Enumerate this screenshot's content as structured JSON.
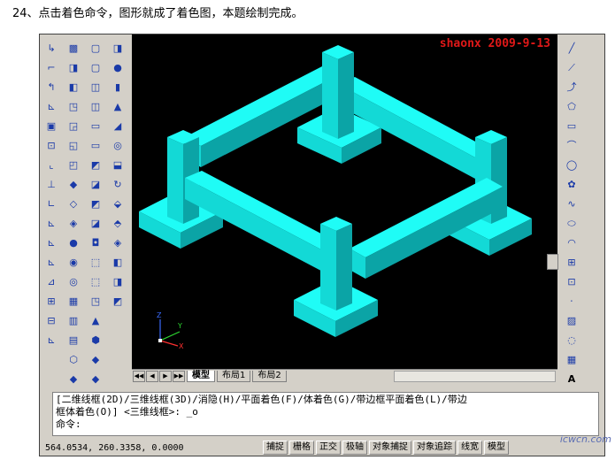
{
  "caption": "24、点击着色命令，图形就成了着色图，本题绘制完成。",
  "watermark": "shaonx 2009-9-13",
  "tabs": {
    "nav": [
      "◀◀",
      "◀",
      "▶",
      "▶▶"
    ],
    "model": "模型",
    "layout1": "布局1",
    "layout2": "布局2"
  },
  "command": {
    "line1": "[二维线框(2D)/三维线框(3D)/消隐(H)/平面着色(F)/体着色(G)/带边框平面着色(L)/带边",
    "line2": "框体着色(O)] <三维线框>: _o",
    "prompt": "命令:"
  },
  "status": {
    "coords": "564.0534, 260.3358, 0.0000",
    "buttons": [
      "捕捉",
      "栅格",
      "正交",
      "极轴",
      "对象捕捉",
      "对象追踪",
      "线宽",
      "模型"
    ]
  },
  "footer_mark": "icwcn.com",
  "ucs": {
    "x": "X",
    "y": "Y",
    "z": "Z"
  },
  "colors": {
    "solid_top": "#1ffcf6",
    "solid_left": "#13d9d6",
    "solid_right": "#0ba4a6",
    "canvas": "#000000"
  },
  "left_toolbar_1": [
    "dim-icon",
    "dim-icon",
    "dim-icon",
    "dim-icon",
    "dim-icon",
    "dim-icon",
    "dim-icon",
    "dim-icon",
    "dim-icon",
    "dim-icon",
    "dim-icon",
    "dim-icon",
    "dim-icon",
    "dim-icon",
    "dim-icon",
    "dim-icon"
  ],
  "right_toolbar": [
    "line",
    "ray",
    "polyline",
    "polygon",
    "rect",
    "arc",
    "circle",
    "revcloud",
    "spline",
    "ellipse",
    "ellipse-arc",
    "block",
    "point",
    "hatch",
    "region",
    "text"
  ]
}
